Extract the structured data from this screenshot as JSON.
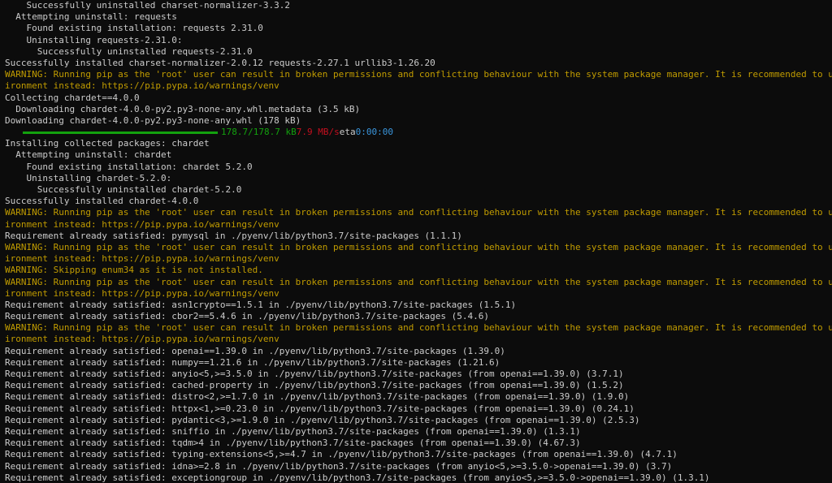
{
  "lines": [
    {
      "text": "    Successfully uninstalled charset-normalizer-3.3.2",
      "kind": "normal"
    },
    {
      "text": "  Attempting uninstall: requests",
      "kind": "normal"
    },
    {
      "text": "    Found existing installation: requests 2.31.0",
      "kind": "normal"
    },
    {
      "text": "    Uninstalling requests-2.31.0:",
      "kind": "normal"
    },
    {
      "text": "      Successfully uninstalled requests-2.31.0",
      "kind": "normal"
    },
    {
      "text": "Successfully installed charset-normalizer-2.0.12 requests-2.27.1 urllib3-1.26.20",
      "kind": "normal"
    },
    {
      "text": "WARNING: Running pip as the 'root' user can result in broken permissions and conflicting behaviour with the system package manager. It is recommended to use a virtual env",
      "kind": "warn"
    },
    {
      "text": "ironment instead: https://pip.pypa.io/warnings/venv",
      "kind": "warn"
    },
    {
      "text": "Collecting chardet==4.0.0",
      "kind": "normal"
    },
    {
      "text": "  Downloading chardet-4.0.0-py2.py3-none-any.whl.metadata (3.5 kB)",
      "kind": "normal"
    },
    {
      "text": "Downloading chardet-4.0.0-py2.py3-none-any.whl (178 kB)",
      "kind": "normal"
    },
    {
      "kind": "progress"
    },
    {
      "text": "Installing collected packages: chardet",
      "kind": "normal"
    },
    {
      "text": "  Attempting uninstall: chardet",
      "kind": "normal"
    },
    {
      "text": "    Found existing installation: chardet 5.2.0",
      "kind": "normal"
    },
    {
      "text": "    Uninstalling chardet-5.2.0:",
      "kind": "normal"
    },
    {
      "text": "      Successfully uninstalled chardet-5.2.0",
      "kind": "normal"
    },
    {
      "text": "Successfully installed chardet-4.0.0",
      "kind": "normal"
    },
    {
      "text": "WARNING: Running pip as the 'root' user can result in broken permissions and conflicting behaviour with the system package manager. It is recommended to use a virtual env",
      "kind": "warn"
    },
    {
      "text": "ironment instead: https://pip.pypa.io/warnings/venv",
      "kind": "warn"
    },
    {
      "text": "Requirement already satisfied: pymysql in ./pyenv/lib/python3.7/site-packages (1.1.1)",
      "kind": "normal"
    },
    {
      "text": "WARNING: Running pip as the 'root' user can result in broken permissions and conflicting behaviour with the system package manager. It is recommended to use a virtual env",
      "kind": "warn"
    },
    {
      "text": "ironment instead: https://pip.pypa.io/warnings/venv",
      "kind": "warn"
    },
    {
      "text": "WARNING: Skipping enum34 as it is not installed.",
      "kind": "warn"
    },
    {
      "text": "WARNING: Running pip as the 'root' user can result in broken permissions and conflicting behaviour with the system package manager. It is recommended to use a virtual env",
      "kind": "warn"
    },
    {
      "text": "ironment instead: https://pip.pypa.io/warnings/venv",
      "kind": "warn"
    },
    {
      "text": "Requirement already satisfied: asn1crypto==1.5.1 in ./pyenv/lib/python3.7/site-packages (1.5.1)",
      "kind": "normal"
    },
    {
      "text": "Requirement already satisfied: cbor2==5.4.6 in ./pyenv/lib/python3.7/site-packages (5.4.6)",
      "kind": "normal"
    },
    {
      "text": "WARNING: Running pip as the 'root' user can result in broken permissions and conflicting behaviour with the system package manager. It is recommended to use a virtual env",
      "kind": "warn"
    },
    {
      "text": "ironment instead: https://pip.pypa.io/warnings/venv",
      "kind": "warn"
    },
    {
      "text": "Requirement already satisfied: openai==1.39.0 in ./pyenv/lib/python3.7/site-packages (1.39.0)",
      "kind": "normal"
    },
    {
      "text": "Requirement already satisfied: numpy==1.21.6 in ./pyenv/lib/python3.7/site-packages (1.21.6)",
      "kind": "normal"
    },
    {
      "text": "Requirement already satisfied: anyio<5,>=3.5.0 in ./pyenv/lib/python3.7/site-packages (from openai==1.39.0) (3.7.1)",
      "kind": "normal"
    },
    {
      "text": "Requirement already satisfied: cached-property in ./pyenv/lib/python3.7/site-packages (from openai==1.39.0) (1.5.2)",
      "kind": "normal"
    },
    {
      "text": "Requirement already satisfied: distro<2,>=1.7.0 in ./pyenv/lib/python3.7/site-packages (from openai==1.39.0) (1.9.0)",
      "kind": "normal"
    },
    {
      "text": "Requirement already satisfied: httpx<1,>=0.23.0 in ./pyenv/lib/python3.7/site-packages (from openai==1.39.0) (0.24.1)",
      "kind": "normal"
    },
    {
      "text": "Requirement already satisfied: pydantic<3,>=1.9.0 in ./pyenv/lib/python3.7/site-packages (from openai==1.39.0) (2.5.3)",
      "kind": "normal"
    },
    {
      "text": "Requirement already satisfied: sniffio in ./pyenv/lib/python3.7/site-packages (from openai==1.39.0) (1.3.1)",
      "kind": "normal"
    },
    {
      "text": "Requirement already satisfied: tqdm>4 in ./pyenv/lib/python3.7/site-packages (from openai==1.39.0) (4.67.3)",
      "kind": "normal"
    },
    {
      "text": "Requirement already satisfied: typing-extensions<5,>=4.7 in ./pyenv/lib/python3.7/site-packages (from openai==1.39.0) (4.7.1)",
      "kind": "normal"
    },
    {
      "text": "Requirement already satisfied: idna>=2.8 in ./pyenv/lib/python3.7/site-packages (from anyio<5,>=3.5.0->openai==1.39.0) (3.7)",
      "kind": "normal"
    },
    {
      "text": "Requirement already satisfied: exceptiongroup in ./pyenv/lib/python3.7/site-packages (from anyio<5,>=3.5.0->openai==1.39.0) (1.3.1)",
      "kind": "normal"
    }
  ],
  "progress": {
    "fraction": 1.0,
    "size": "178.7/178.7 kB",
    "speed": "7.9 MB/s",
    "eta_label": "eta",
    "eta": "0:00:00"
  },
  "colors": {
    "background": "#0c0c0c",
    "text": "#cccccc",
    "warning": "#c19c00",
    "progress_bar": "#13a10e",
    "speed": "#c50f1f",
    "eta": "#3a96dd"
  }
}
